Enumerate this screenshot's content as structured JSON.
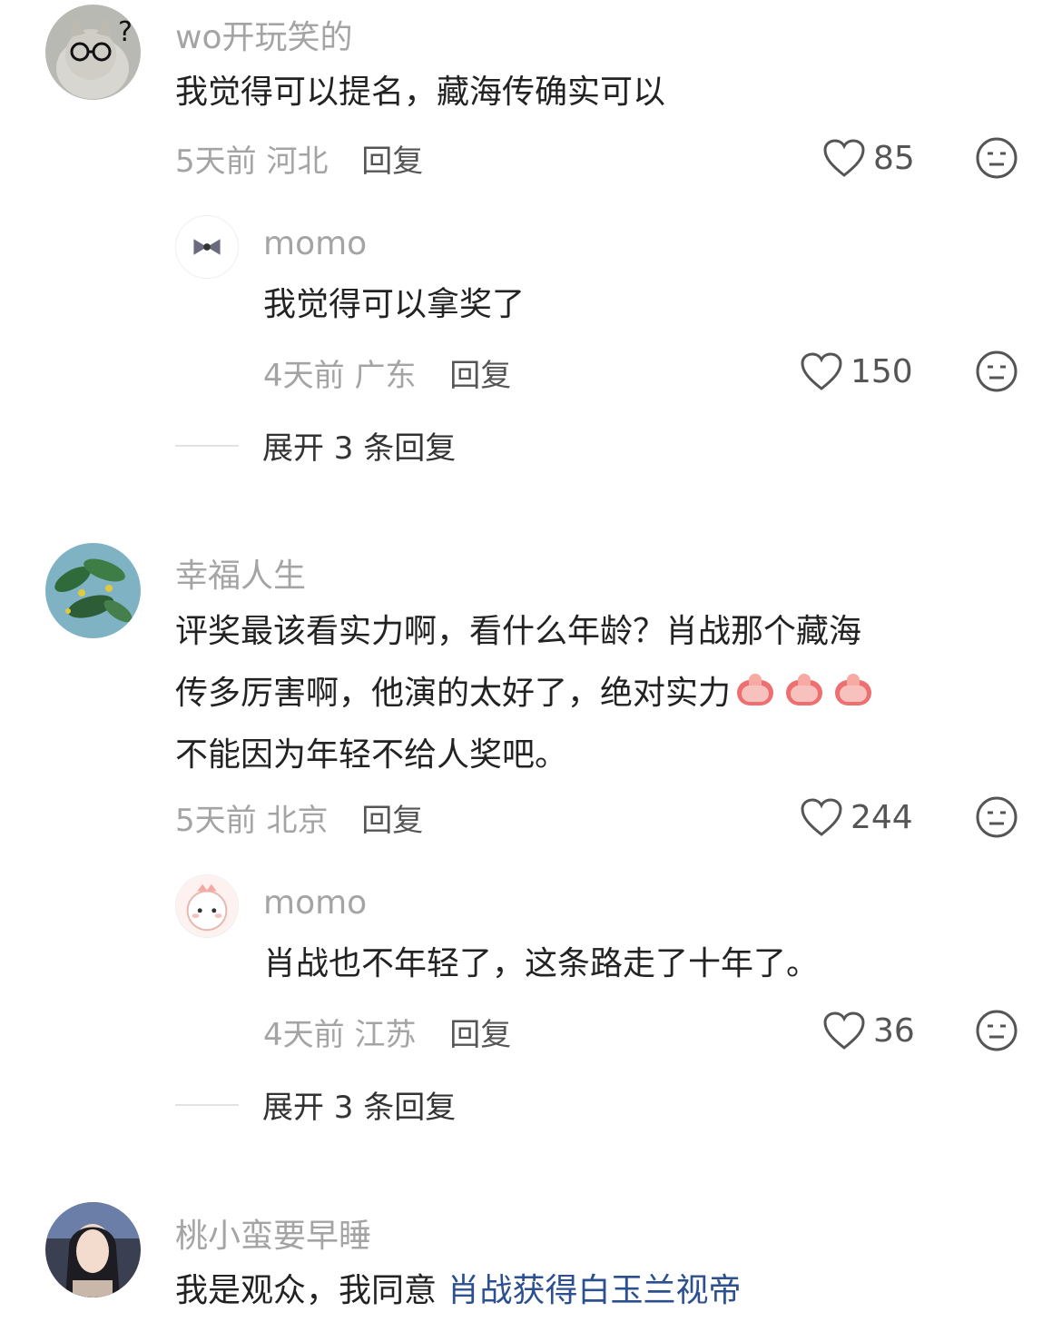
{
  "comments": [
    {
      "username": "wo开玩笑的",
      "avatar_icon": "cat-with-glasses-avatar",
      "text": "我觉得可以提名，藏海传确实可以",
      "time": "5天前",
      "location": "河北",
      "reply_label": "回复",
      "likes": "85",
      "replies": [
        {
          "username": "momo",
          "avatar_icon": "bow-avatar",
          "text": "我觉得可以拿奖了",
          "time": "4天前",
          "location": "广东",
          "reply_label": "回复",
          "likes": "150"
        }
      ],
      "expand_label": "展开 3 条回复"
    },
    {
      "username": "幸福人生",
      "avatar_icon": "green-leaves-avatar",
      "text_line1": "评奖最该看实力啊，看什么年龄？肖战那个藏海",
      "text_line2": "传多厉害啊，他演的太好了，绝对实力",
      "text_line3": "不能因为年轻不给人奖吧。",
      "emoji": "thumbs-up-icon",
      "time": "5天前",
      "location": "北京",
      "reply_label": "回复",
      "likes": "244",
      "replies": [
        {
          "username": "momo",
          "avatar_icon": "cute-dinosaur-avatar",
          "text": "肖战也不年轻了，这条路走了十年了。",
          "time": "4天前",
          "location": "江苏",
          "reply_label": "回复",
          "likes": "36"
        }
      ],
      "expand_label": "展开 3 条回复"
    },
    {
      "username": "桃小蛮要早睡",
      "avatar_icon": "woman-portrait-avatar",
      "text_prefix": "我是观众，我同意 ",
      "text_link": "肖战获得白玉兰视帝"
    }
  ],
  "colors": {
    "meta_gray": "#a4a4a4",
    "text": "#222222",
    "link": "#2c4f8f"
  }
}
